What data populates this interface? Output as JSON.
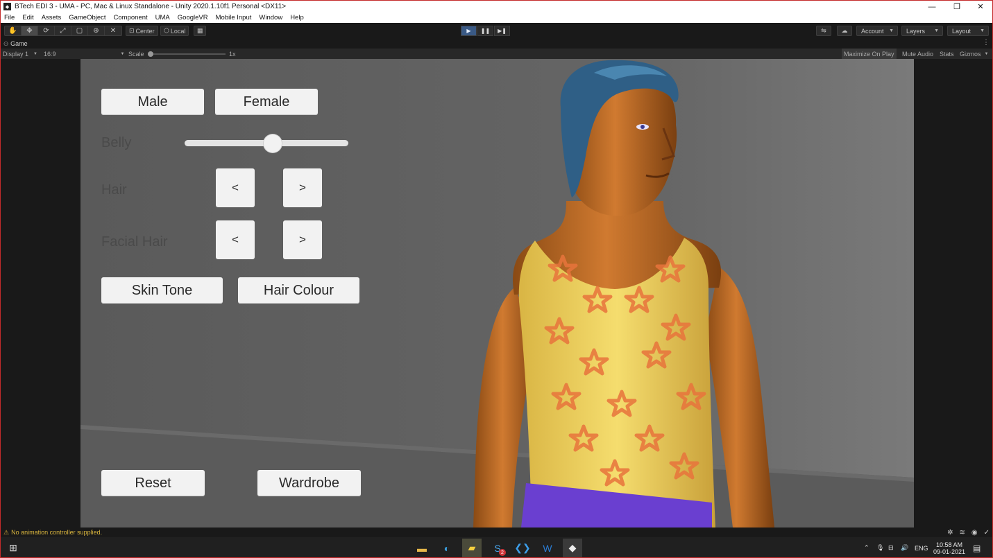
{
  "window": {
    "title": "BTech EDI 3 - UMA - PC, Mac & Linux Standalone - Unity 2020.1.10f1 Personal <DX11>",
    "minimize": "—",
    "maximize": "❐",
    "close": "✕"
  },
  "menu": [
    "File",
    "Edit",
    "Assets",
    "GameObject",
    "Component",
    "UMA",
    "GoogleVR",
    "Mobile Input",
    "Window",
    "Help"
  ],
  "toolbar": {
    "tools": [
      "hand-icon",
      "move-icon",
      "rotate-icon",
      "scale-icon",
      "rect-icon",
      "transform-icon",
      "custom-tool-icon"
    ],
    "pivot": "Center",
    "space": "Local",
    "account": "Account",
    "layers": "Layers",
    "layout": "Layout"
  },
  "game_tab": {
    "label": "Game",
    "display": "Display 1",
    "aspect": "16:9",
    "scale_label": "Scale",
    "scale_value": "1x",
    "maximize_on_play": "Maximize On Play",
    "mute_audio": "Mute Audio",
    "stats": "Stats",
    "gizmos": "Gizmos"
  },
  "game_ui": {
    "male": "Male",
    "female": "Female",
    "belly": "Belly",
    "belly_value": 0.54,
    "hair": "Hair",
    "facial_hair": "Facial Hair",
    "prev": "<",
    "next": ">",
    "skin_tone": "Skin Tone",
    "hair_colour": "Hair Colour",
    "reset": "Reset",
    "wardrobe": "Wardrobe"
  },
  "status": {
    "message": "No animation controller supplied."
  },
  "taskbar": {
    "language": "ENG",
    "time": "10:58 AM",
    "date": "09-01-2021",
    "badge": "2"
  },
  "colors": {
    "unity_dark": "#191919",
    "play_active": "#3a5a86",
    "warning": "#e0b23a",
    "window_border": "#c42b2b",
    "shirt_yellow": "#f0d25c",
    "star_orange": "#e8743c",
    "hair_blue": "#2f5f86",
    "skin": "#d07a30"
  }
}
